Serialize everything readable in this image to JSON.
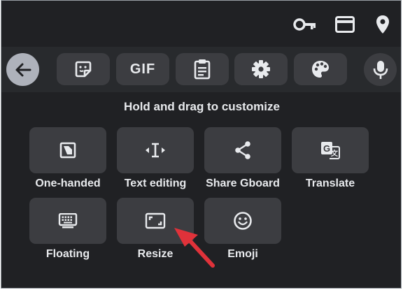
{
  "top_icons": [
    {
      "icon": "key-icon"
    },
    {
      "icon": "credit-card-icon"
    },
    {
      "icon": "location-pin-icon"
    }
  ],
  "toolbar": {
    "back_icon": "arrow-back-icon",
    "items": [
      {
        "icon": "sticker-icon"
      },
      {
        "label": "GIF"
      },
      {
        "icon": "clipboard-icon"
      },
      {
        "icon": "gear-icon"
      },
      {
        "icon": "palette-icon"
      }
    ],
    "mic_icon": "microphone-icon"
  },
  "hint": "Hold and drag to customize",
  "tiles": [
    {
      "label": "One-handed",
      "icon": "one-handed-icon"
    },
    {
      "label": "Text editing",
      "icon": "text-cursor-icon"
    },
    {
      "label": "Share Gboard",
      "icon": "share-icon"
    },
    {
      "label": "Translate",
      "icon": "translate-icon"
    },
    {
      "label": "Floating",
      "icon": "keyboard-icon"
    },
    {
      "label": "Resize",
      "icon": "resize-icon"
    },
    {
      "label": "Emoji",
      "icon": "smiley-icon"
    }
  ],
  "colors": {
    "background": "#202124",
    "toolbar": "#282a2d",
    "tile": "#3c3d41",
    "text": "#e8eaed",
    "annotation_arrow": "#e0323a"
  }
}
